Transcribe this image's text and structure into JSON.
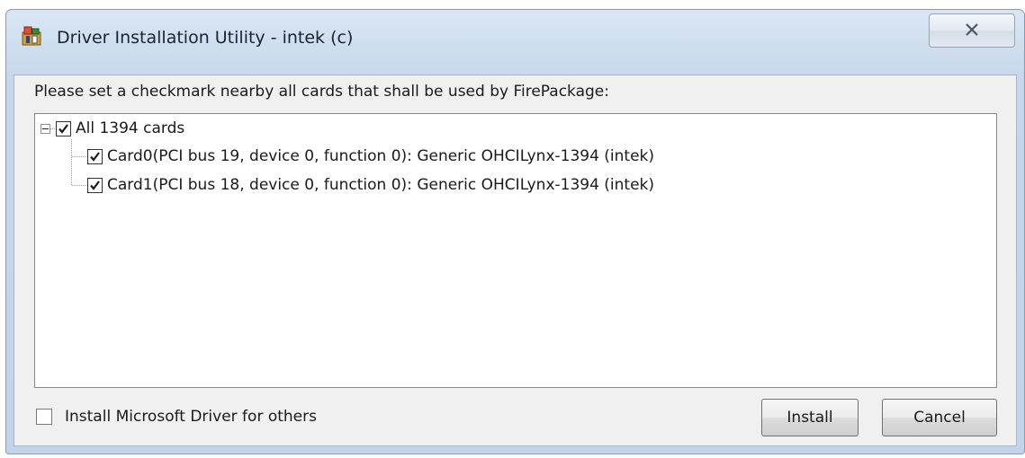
{
  "window": {
    "title": "Driver Installation Utility - intek (c)",
    "icon": "driver-utility-app-icon",
    "close_icon": "close-x-icon"
  },
  "instruction": "Please set a checkmark nearby all cards that shall be used by FirePackage:",
  "tree": {
    "root": {
      "label": "All 1394 cards",
      "checked": true,
      "expanded": true
    },
    "children": [
      {
        "label": "Card0(PCI bus 19, device 0, function 0): Generic OHCILynx-1394 (intek)",
        "checked": true
      },
      {
        "label": "Card1(PCI bus 18, device 0, function 0): Generic OHCILynx-1394 (intek)",
        "checked": true
      }
    ]
  },
  "options": {
    "install_ms_driver_label": "Install Microsoft Driver for others",
    "install_ms_driver_checked": false
  },
  "buttons": {
    "install": "Install",
    "cancel": "Cancel"
  }
}
